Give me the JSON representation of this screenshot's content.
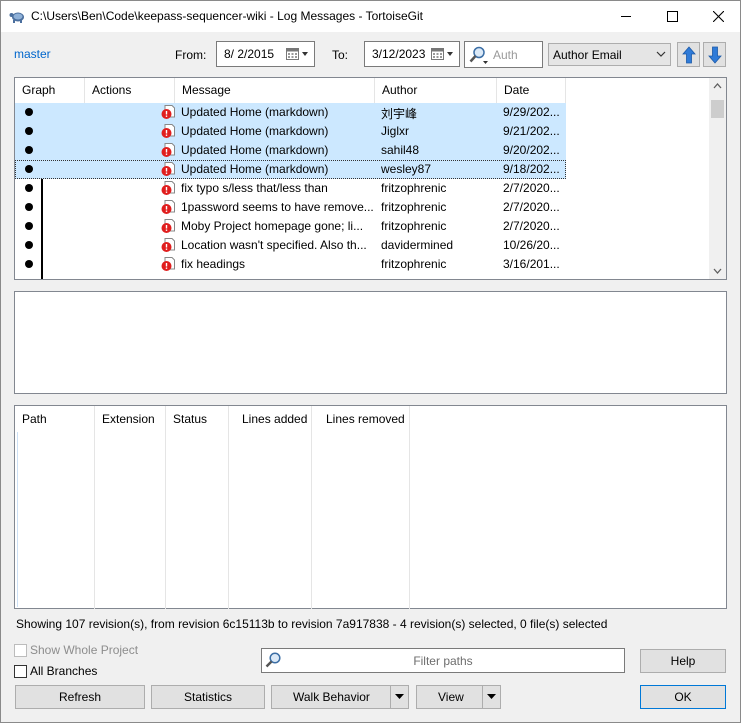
{
  "window": {
    "title": "C:\\Users\\Ben\\Code\\keepass-sequencer-wiki - Log Messages - TortoiseGit"
  },
  "toolbar": {
    "branch": "master",
    "from_label": "From:",
    "from_date": "8/  2/2015",
    "to_label": "To:",
    "to_date": "3/12/2023",
    "search_placeholder": "Auth",
    "filter_field": "Author Email"
  },
  "log": {
    "columns": [
      "Graph",
      "Actions",
      "Message",
      "Author",
      "Date"
    ],
    "rows": [
      {
        "message": "Updated Home (markdown)",
        "author": "刘宇峰",
        "date": "9/29/202...",
        "selected": true
      },
      {
        "message": "Updated Home (markdown)",
        "author": "Jiglxr",
        "date": "9/21/202...",
        "selected": true
      },
      {
        "message": "Updated Home (markdown)",
        "author": "sahil48",
        "date": "9/20/202...",
        "selected": true
      },
      {
        "message": "Updated Home (markdown)",
        "author": "wesley87",
        "date": "9/18/202...",
        "selected": true
      },
      {
        "message": "fix typo s/less that/less than",
        "author": "fritzophrenic",
        "date": "2/7/2020...",
        "selected": false
      },
      {
        "message": "1password seems to have remove...",
        "author": "fritzophrenic",
        "date": "2/7/2020...",
        "selected": false
      },
      {
        "message": "Moby Project homepage gone; li...",
        "author": "fritzophrenic",
        "date": "2/7/2020...",
        "selected": false
      },
      {
        "message": "Location wasn't specified. Also th...",
        "author": "davidermined",
        "date": "10/26/20...",
        "selected": false
      },
      {
        "message": "fix headings",
        "author": "fritzophrenic",
        "date": "3/16/201...",
        "selected": false
      }
    ]
  },
  "files": {
    "columns": [
      "Path",
      "Extension",
      "Status",
      "Lines added",
      "Lines removed"
    ]
  },
  "status": {
    "text": "Showing 107 revision(s), from revision 6c15113b to revision 7a917838 - 4 revision(s) selected, 0 file(s) selected"
  },
  "options": {
    "show_whole_project": "Show Whole Project",
    "all_branches": "All Branches"
  },
  "filter": {
    "placeholder": "Filter paths"
  },
  "buttons": {
    "help": "Help",
    "refresh": "Refresh",
    "statistics": "Statistics",
    "walk_behavior": "Walk Behavior",
    "view": "View",
    "ok": "OK"
  },
  "colors": {
    "selection": "#cce8ff",
    "link": "#0066cc",
    "arrow_blue": "#2f7bd8"
  }
}
